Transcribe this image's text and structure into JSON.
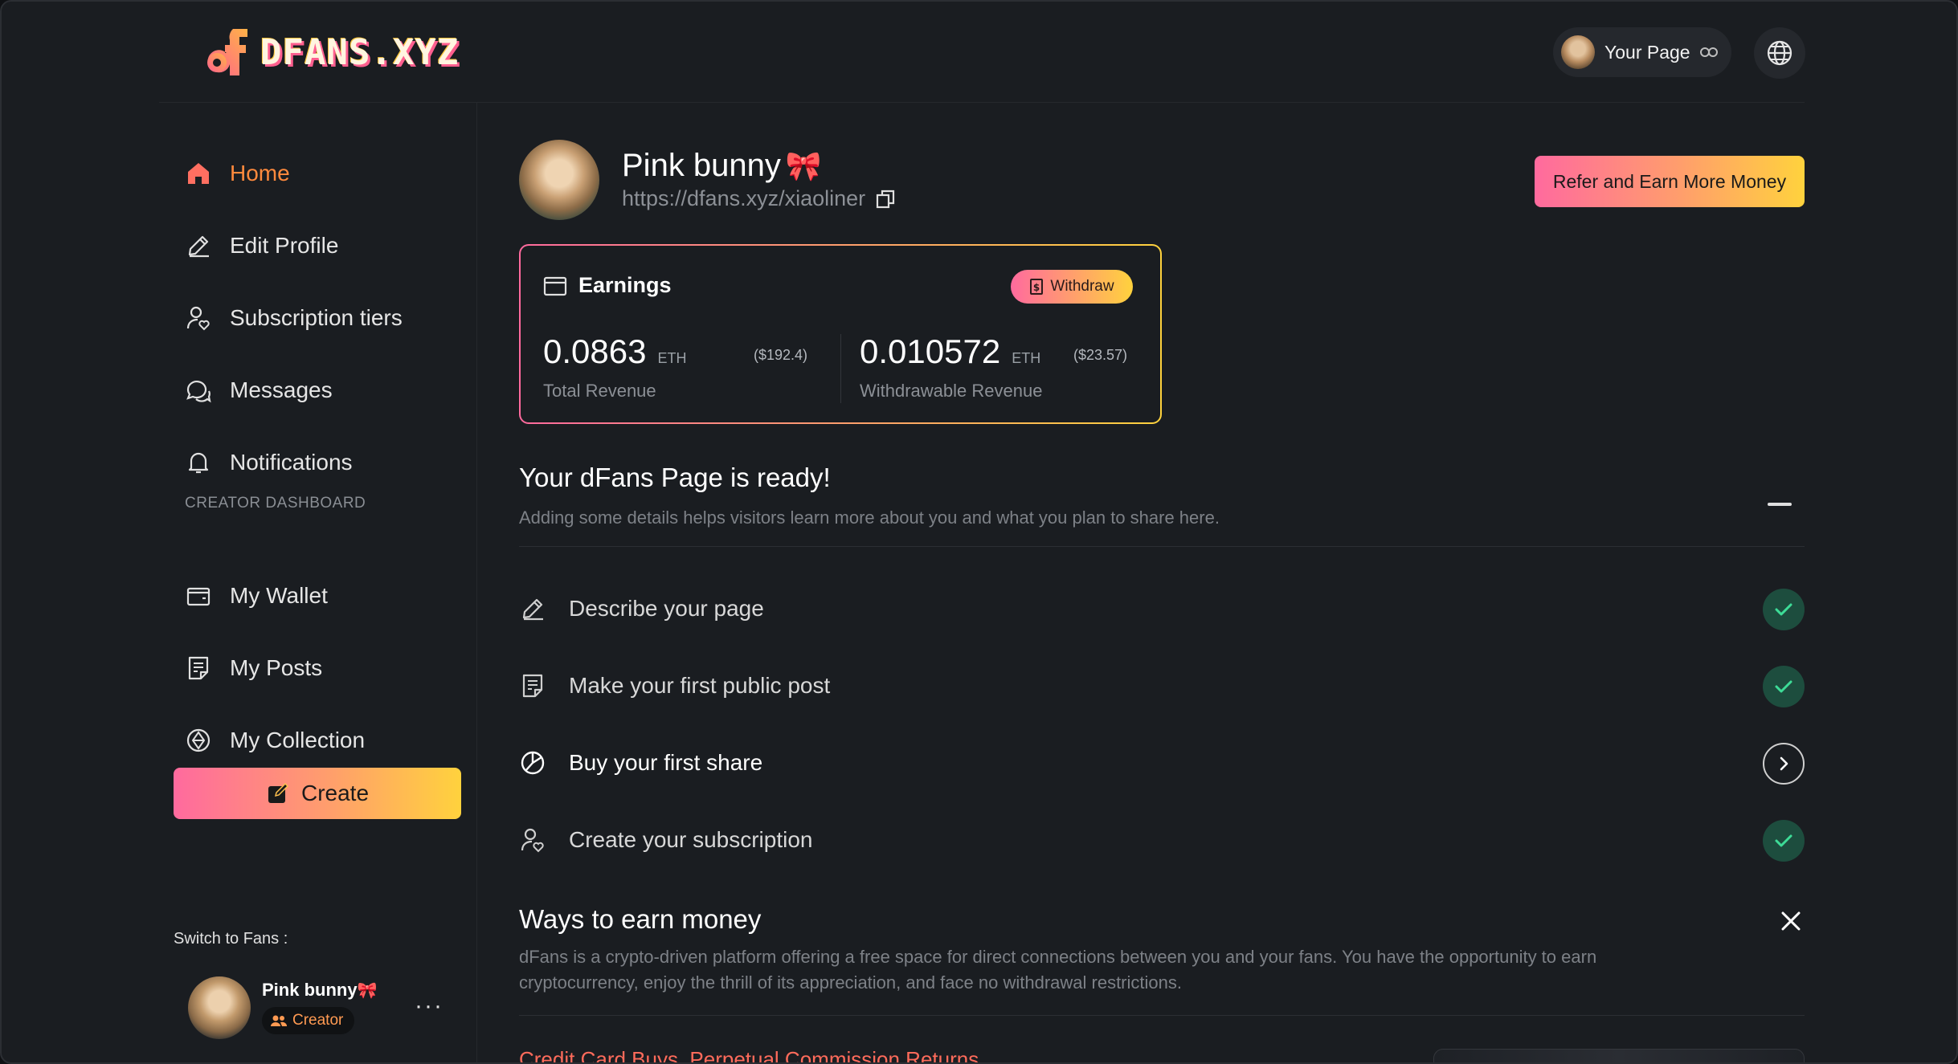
{
  "header": {
    "logo_text": "DFANS.XYZ",
    "your_page_label": "Your Page"
  },
  "sidebar": {
    "items": [
      {
        "label": "Home",
        "icon": "home-icon",
        "active": true
      },
      {
        "label": "Edit Profile",
        "icon": "pencil-icon"
      },
      {
        "label": "Subscription tiers",
        "icon": "user-heart-icon"
      },
      {
        "label": "Messages",
        "icon": "chat-icon"
      },
      {
        "label": "Notifications",
        "icon": "bell-icon"
      }
    ],
    "section_label": "CREATOR DASHBOARD",
    "creator_items": [
      {
        "label": "My Wallet",
        "icon": "wallet-icon"
      },
      {
        "label": "My Posts",
        "icon": "post-icon"
      },
      {
        "label": "My Collection",
        "icon": "collection-icon"
      }
    ],
    "create_label": "Create",
    "switch_label": "Switch to Fans :",
    "user": {
      "name": "Pink bunny",
      "badge": "Creator"
    }
  },
  "profile": {
    "name": "Pink bunny",
    "url": "https://dfans.xyz/xiaoliner",
    "refer_label": "Refer and Earn More Money"
  },
  "earnings": {
    "title": "Earnings",
    "withdraw_label": "Withdraw",
    "total": {
      "value": "0.0863",
      "unit": "ETH",
      "usd": "($192.4)",
      "label": "Total Revenue"
    },
    "withdrawable": {
      "value": "0.010572",
      "unit": "ETH",
      "usd": "($23.57)",
      "label": "Withdrawable Revenue"
    }
  },
  "ready": {
    "title": "Your dFans Page is ready!",
    "subtitle": "Adding some details helps visitors learn more about you and what you plan to share here.",
    "tasks": [
      {
        "label": "Describe your page",
        "done": true
      },
      {
        "label": "Make your first public post",
        "done": true
      },
      {
        "label": "Buy your first share",
        "done": false
      },
      {
        "label": "Create your subscription",
        "done": true
      }
    ]
  },
  "ways": {
    "title": "Ways to earn money",
    "description": "dFans is a crypto-driven platform offering a free space for direct connections between you and your fans. You have the opportunity to earn cryptocurrency, enjoy the thrill of its appreciation, and face no withdrawal restrictions.",
    "link": "Credit Card Buys, Perpetual Commission Returns"
  },
  "colors": {
    "accent_orange": "#ff8a3d",
    "gradient_start": "#ff6a9e",
    "gradient_end": "#ffd23d",
    "success_green": "#1d4d3e",
    "link_red": "#ff6b5b"
  }
}
